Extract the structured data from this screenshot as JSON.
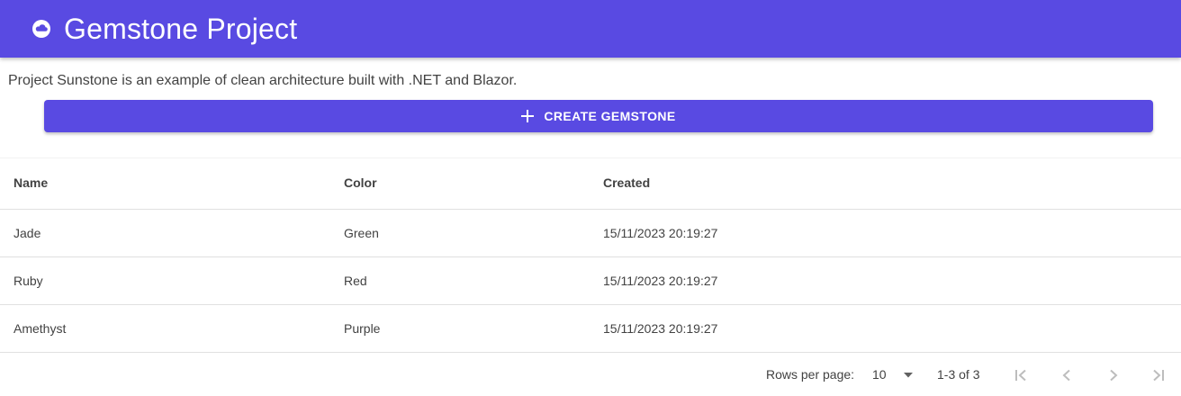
{
  "appbar": {
    "title": "Gemstone Project",
    "logo_icon": "cloud-icon",
    "background": "#594ae2"
  },
  "intro": {
    "text": "Project Sunstone is an example of clean architecture built with .NET and Blazor."
  },
  "create_button": {
    "label": "CREATE GEMSTONE",
    "icon": "plus-icon"
  },
  "table": {
    "columns": [
      "Name",
      "Color",
      "Created"
    ],
    "rows": [
      {
        "name": "Jade",
        "color": "Green",
        "created": "15/11/2023 20:19:27"
      },
      {
        "name": "Ruby",
        "color": "Red",
        "created": "15/11/2023 20:19:27"
      },
      {
        "name": "Amethyst",
        "color": "Purple",
        "created": "15/11/2023 20:19:27"
      }
    ]
  },
  "pager": {
    "rows_per_page_label": "Rows per page:",
    "rows_per_page_value": "10",
    "range": "1-3 of 3"
  }
}
